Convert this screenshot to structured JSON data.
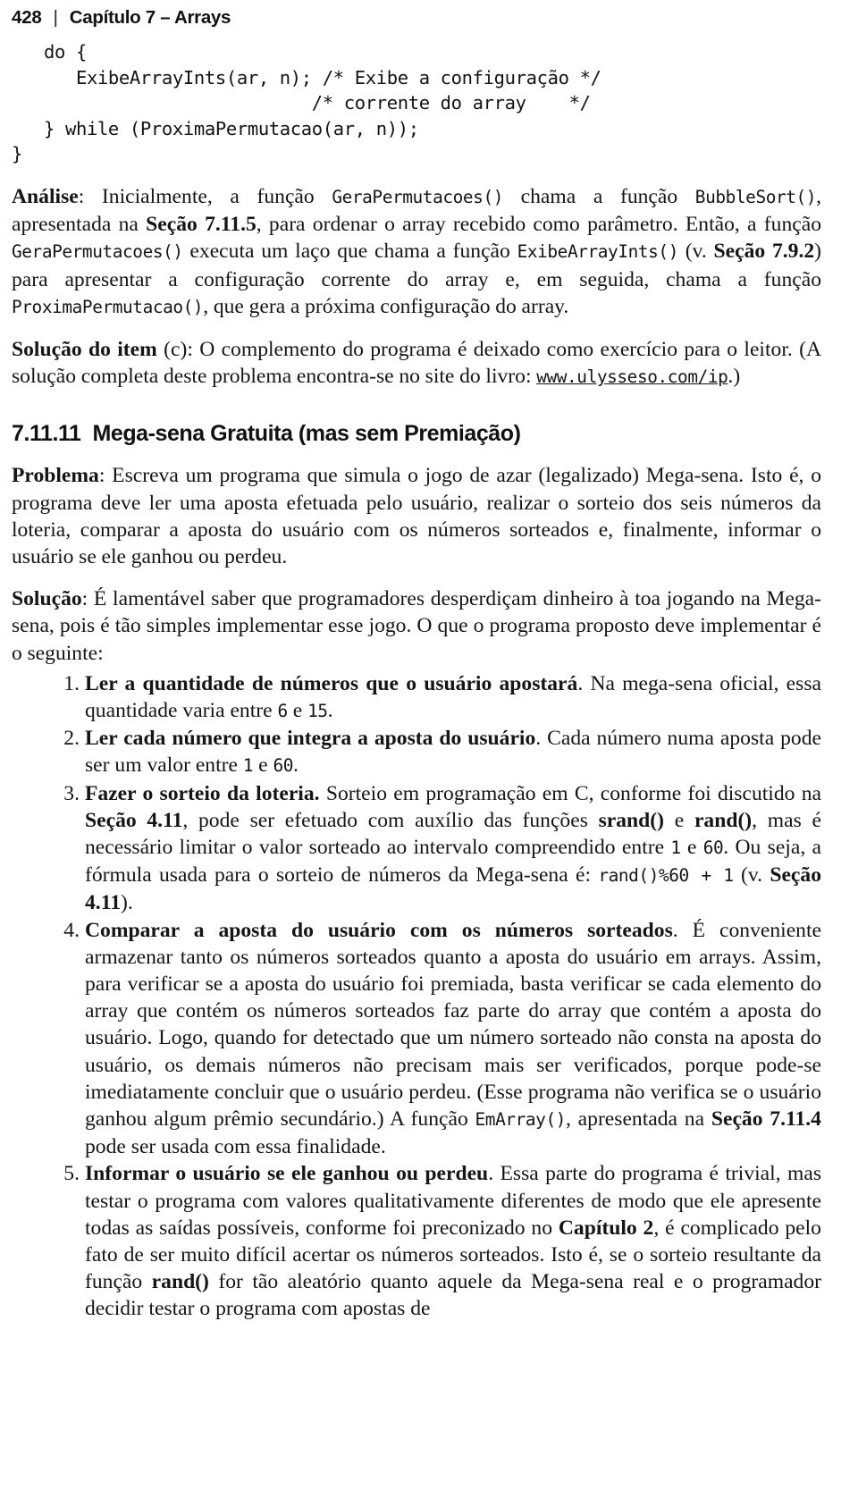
{
  "page": {
    "folio": "428",
    "separator": "|",
    "chapter_title": "Capítulo 7 – Arrays"
  },
  "code_listing": {
    "lines": [
      "   do {",
      "      ExibeArrayInts(ar, n); /* Exibe a configuração */",
      "                            /* corrente do array    */",
      "   } while (ProximaPermutacao(ar, n));",
      "}"
    ]
  },
  "analysis": {
    "label": "Análise",
    "p1_a": ": Inicialmente, a função ",
    "fn_gera_1": "GeraPermutacoes()",
    "p1_b": " chama a função ",
    "fn_bubble": "BubbleSort()",
    "p1_c": ", apresentada na ",
    "ref_7115": "Seção 7.11.5",
    "p1_d": ", para ordenar o array recebido como parâmetro. Então, a função ",
    "fn_gera_2": "GeraPermutacoes()",
    "p1_e": " executa um laço que chama a função ",
    "fn_exibe": "ExibeArrayInts()",
    "p1_f": " (v. ",
    "ref_792": "Seção 7.9.2",
    "p1_g": ") para apresentar a configuração corrente do array e, em seguida, chama a função ",
    "fn_proxima": "ProximaPermutacao()",
    "p1_h": ", que gera a próxima configuração do array."
  },
  "solution_c": {
    "label": "Solução do item",
    "label_item": "(c)",
    "text_a": ": O complemento do programa é deixado como exercício para o leitor. (A solução completa deste problema encontra-se no site do livro: ",
    "url": "www.ulysseso.com/ip",
    "text_b": ".)"
  },
  "section": {
    "number": "7.11.11",
    "title": "Mega-sena Gratuita (mas sem Premiação)"
  },
  "problema": {
    "label": "Problema",
    "text": ": Escreva um programa que simula o jogo de azar (legalizado) Mega-sena. Isto é, o programa deve ler uma aposta efetuada pelo usuário, realizar o sorteio dos seis números da loteria, comparar a aposta do usuário com os números sorteados e, finalmente, informar o usuário se ele ganhou ou perdeu."
  },
  "solucao": {
    "label": "Solução",
    "text": ": É lamentável saber que programadores desperdiçam dinheiro à toa jogando na Mega-sena, pois é tão simples implementar esse jogo. O que o programa proposto deve implementar é o seguinte:"
  },
  "steps": [
    {
      "marker": "1.",
      "bold": "Ler a quantidade de números que o usuário apostará",
      "t1": ". Na mega-sena oficial, essa quantidade varia entre ",
      "m1": "6",
      "t2": " e ",
      "m2": "15",
      "t3": "."
    },
    {
      "marker": "2.",
      "bold": "Ler cada número que integra a aposta do usuário",
      "t1": ". Cada número numa aposta pode ser um valor entre ",
      "m1": "1",
      "t2": " e ",
      "m2": "60",
      "t3": "."
    },
    {
      "marker": "3.",
      "bold": "Fazer o sorteio da loteria.",
      "t1": " Sorteio em programação em C, conforme foi discutido na ",
      "ref1": "Seção 4.11",
      "t2": ", pode ser efetuado com auxílio das funções ",
      "b1": "srand()",
      "t3": " e ",
      "b2": "rand()",
      "t4": ", mas é necessário limitar o valor sorteado ao intervalo compreendido entre ",
      "m1": "1",
      "t5": " e ",
      "m2": "60",
      "t6": ". Ou seja, a fórmula usada para o sorteio de números da Mega-sena é: ",
      "m3": "rand()%60 + 1",
      "t7": " (v. ",
      "ref2": "Seção 4.11",
      "t8": ")."
    },
    {
      "marker": "4.",
      "bold": "Comparar a aposta do usuário com os números sorteados",
      "t1": ". É conveniente armazenar tanto os números sorteados quanto a aposta do usuário em arrays. Assim, para verificar se a aposta do usuário foi premiada, basta verificar se cada elemento do array que contém os números sorteados faz parte do array que contém a aposta do usuário. Logo, quando for detectado que um número sorteado não consta na aposta do usuário, os demais números não precisam mais ser verificados, porque pode-se imediatamente concluir que o usuário perdeu. (Esse programa não verifica se o usuário ganhou algum prêmio secundário.) A função ",
      "m1": "EmArray()",
      "t2": ", apresentada na ",
      "ref1": "Seção 7.11.4",
      "t3": " pode ser usada com essa finalidade."
    },
    {
      "marker": "5.",
      "bold": "Informar o usuário se ele ganhou ou perdeu",
      "t1": ". Essa parte do programa é trivial, mas testar o programa com valores qualitativamente diferentes de modo que ele apresente todas as saídas possíveis, conforme foi preconizado no ",
      "ref1": "Capítulo 2",
      "t2": ", é complicado pelo fato de ser muito difícil acertar os números sorteados. Isto é, se o sorteio resultante da função ",
      "b1": "rand()",
      "t3": " for tão aleatório quanto aquele da Mega-sena real e o programador decidir testar o programa com apostas de"
    }
  ]
}
